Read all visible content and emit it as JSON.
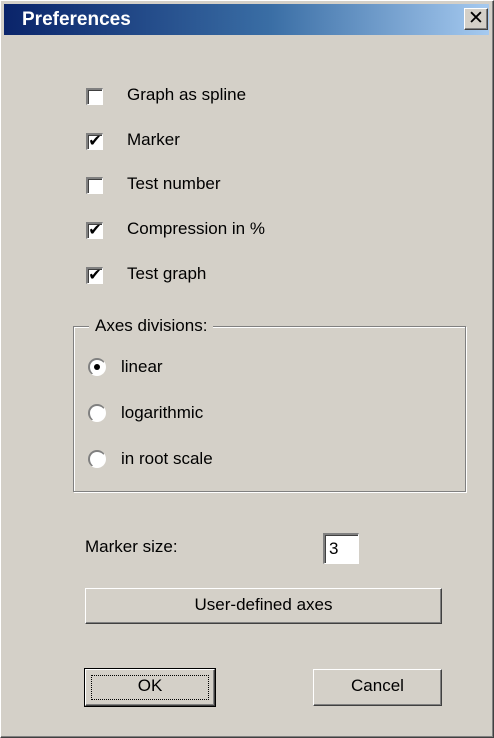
{
  "window": {
    "title": "Preferences",
    "close_glyph": "✕"
  },
  "checkboxes": [
    {
      "label": "Graph as spline",
      "checked": false
    },
    {
      "label": "Marker",
      "checked": true
    },
    {
      "label": "Test number",
      "checked": false
    },
    {
      "label": "Compression in %",
      "checked": true
    },
    {
      "label": "Test graph",
      "checked": true
    }
  ],
  "check_glyph": "✔",
  "axes_group": {
    "title": "Axes divisions:",
    "options": [
      {
        "label": "linear",
        "selected": true
      },
      {
        "label": "logarithmic",
        "selected": false
      },
      {
        "label": "in root scale",
        "selected": false
      }
    ]
  },
  "marker_size": {
    "label": "Marker size:",
    "value": "3"
  },
  "buttons": {
    "user_axes": "User-defined axes",
    "ok": "OK",
    "cancel": "Cancel"
  }
}
